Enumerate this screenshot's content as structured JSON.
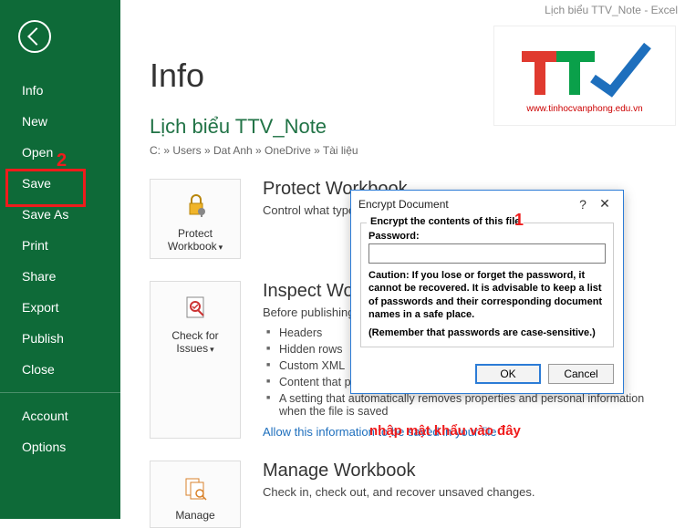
{
  "topbar": {
    "title": "Lịch biểu TTV_Note - Excel"
  },
  "sidebar": {
    "items": [
      {
        "label": "Info"
      },
      {
        "label": "New"
      },
      {
        "label": "Open"
      },
      {
        "label": "Save"
      },
      {
        "label": "Save As"
      },
      {
        "label": "Print"
      },
      {
        "label": "Share"
      },
      {
        "label": "Export"
      },
      {
        "label": "Publish"
      },
      {
        "label": "Close"
      },
      {
        "label": "Account"
      },
      {
        "label": "Options"
      }
    ]
  },
  "annotations": {
    "two": "2",
    "one": "1",
    "password_hint": "nhập mật khẩu vào đây"
  },
  "info": {
    "page_title": "Info",
    "doc_name": "Lịch biểu TTV_Note",
    "breadcrumb": "C: » Users » Dat Anh » OneDrive » Tài liệu"
  },
  "logo": {
    "url": "www.tinhocvanphong.edu.vn"
  },
  "protect": {
    "tile": "Protect Workbook",
    "heading": "Protect Workbook",
    "sub": "Control what types"
  },
  "inspect": {
    "tile": "Check for Issues",
    "heading": "Inspect Workbook",
    "sub": "Before publishing t",
    "bullets": [
      "Headers",
      "Hidden rows",
      "Custom XML",
      "Content that people with disabilities are unable to read",
      "A setting that automatically removes properties and personal information when the file is saved"
    ],
    "link": "Allow this information to be saved in your file"
  },
  "manage": {
    "tile": "Manage",
    "heading": "Manage Workbook",
    "sub": "Check in, check out, and recover unsaved changes."
  },
  "dialog": {
    "title": "Encrypt Document",
    "help": "?",
    "close": "✕",
    "legend": "Encrypt the contents of this file",
    "pw_label": "Password:",
    "pw_value": "",
    "caution": "Caution: If you lose or forget the password, it cannot be recovered. It is advisable to keep a list of passwords and their corresponding document names in a safe place.",
    "remember": "(Remember that passwords are case-sensitive.)",
    "ok": "OK",
    "cancel": "Cancel"
  }
}
